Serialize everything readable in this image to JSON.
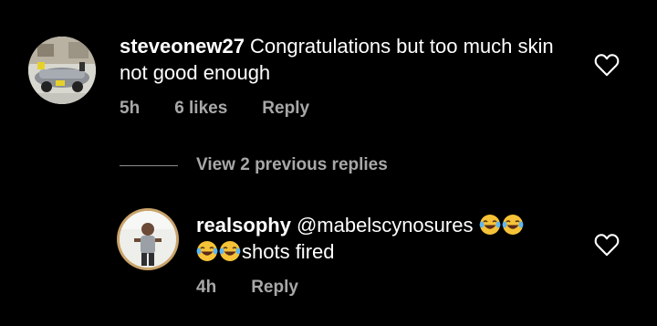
{
  "comments": [
    {
      "username": "steveonew27",
      "text": "Congratulations but too much skin not good enough",
      "time": "5h",
      "likes": "6 likes",
      "reply_label": "Reply",
      "avatar_icon": "car-photo-avatar"
    },
    {
      "username": "realsophy",
      "mention": "@mabelscynosures",
      "text": "shots fired",
      "emoji_name": "face-with-tears-of-joy",
      "time": "4h",
      "reply_label": "Reply",
      "avatar_icon": "person-photo-avatar"
    }
  ],
  "view_replies_label": "View 2 previous replies",
  "colors": {
    "background": "#000000",
    "text": "#ffffff",
    "meta": "#a8a8a8",
    "ring": "#c9a36a"
  }
}
